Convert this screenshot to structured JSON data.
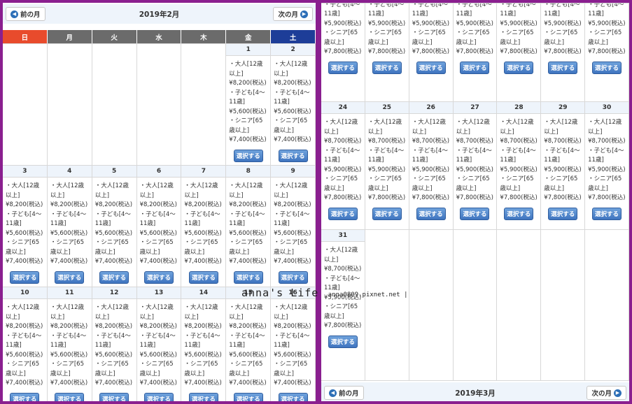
{
  "feb": {
    "title": "2019年2月",
    "prev_label": "前の月",
    "next_label": "次の月",
    "weekdays": [
      "日",
      "月",
      "火",
      "水",
      "木",
      "金",
      "土"
    ]
  },
  "mar": {
    "title": "2019年3月",
    "prev_label": "前の月",
    "next_label": "次の月"
  },
  "labels": {
    "adult": "・大人[12歳以上]",
    "child": "・子ども[4～11歳]",
    "senior": "・シニア[65歳以上]",
    "select": "選択する"
  },
  "prices": {
    "feb_adult": "¥8,200(税込)",
    "feb_child": "¥5,600(税込)",
    "feb_senior": "¥7,400(税込)",
    "mar_adult": "¥8,700(税込)",
    "mar_child": "¥5,900(税込)",
    "mar_senior": "¥7,800(税込)"
  },
  "watermark": {
    "big": "anna's Life",
    "small": "anna0809.pixnet.net |"
  },
  "feb_days": [
    "1",
    "2",
    "3",
    "4",
    "5",
    "6",
    "7",
    "8",
    "9",
    "10",
    "11",
    "12",
    "13",
    "14",
    "15",
    "16"
  ],
  "mar_days": [
    "24",
    "25",
    "26",
    "27",
    "28",
    "29",
    "30",
    "31"
  ]
}
